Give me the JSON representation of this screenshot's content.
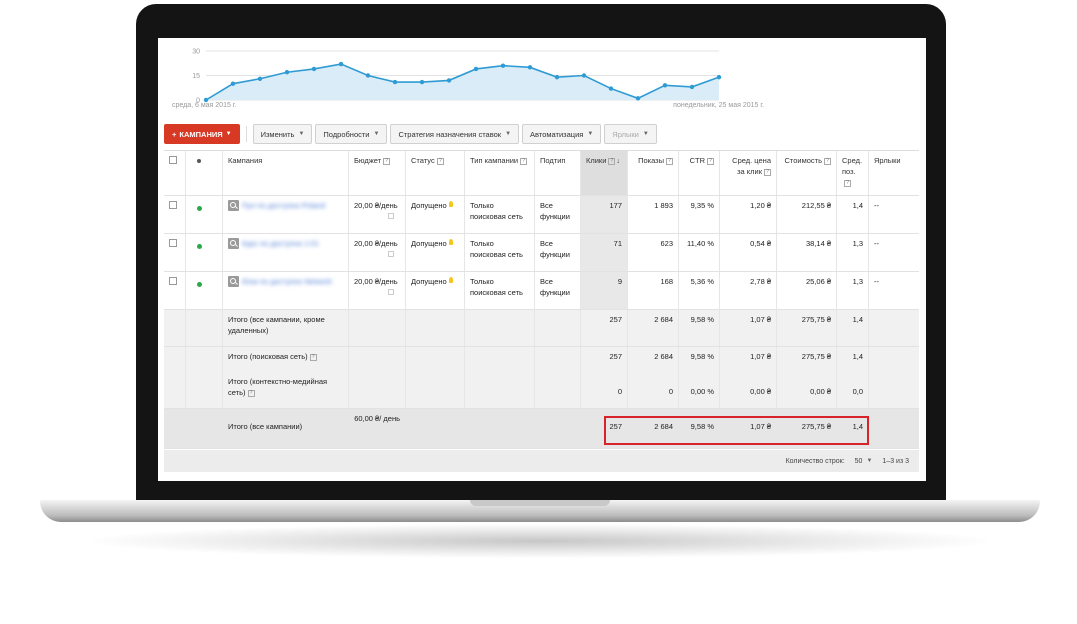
{
  "chart_data": {
    "type": "area",
    "title": "",
    "x_start_label": "среда, 6 мая 2015 г.",
    "x_end_label": "понедельник, 25 мая 2015 г.",
    "ylim": [
      0,
      30
    ],
    "y_ticks": [
      0,
      15,
      30
    ],
    "series": [
      {
        "values": [
          0,
          10,
          13,
          17,
          19,
          22,
          15,
          11,
          11,
          12,
          19,
          21,
          20,
          14,
          15,
          7,
          1,
          9,
          8,
          14
        ]
      }
    ],
    "colors": {
      "line": "#2f9bd4",
      "fill": "#d9ecf7"
    }
  },
  "toolbar": {
    "campaign_btn": "КАМПАНИЯ",
    "plus_icon": "plus-icon",
    "buttons": [
      "Изменить",
      "Подробности",
      "Стратегия назначения ставок",
      "Автоматизация",
      "Ярлыки"
    ]
  },
  "headers": {
    "campaign": "Кампания",
    "budget": "Бюджет",
    "status": "Статус",
    "campaign_type": "Тип кампании",
    "subtype": "Подтип",
    "clicks": "Клики",
    "impressions": "Показы",
    "ctr": "CTR",
    "avg_cpc": "Сред. цена за клик",
    "cost": "Стоимость",
    "avg_pos": "Сред. поз.",
    "labels": "Ярлыки"
  },
  "rows": [
    {
      "name": "Пул по доступно Poland",
      "budget": "20,00 ₴/день",
      "status": "Допущено",
      "type": "Только поисковая сеть",
      "subtype": "Все функции",
      "clicks": "177",
      "impressions": "1 893",
      "ctr": "9,35 %",
      "cpc": "1,20 ₴",
      "cost": "212,55 ₴",
      "pos": "1,4",
      "labels": "--"
    },
    {
      "name": "Курс по доступно 1:01",
      "budget": "20,00 ₴/день",
      "status": "Допущено",
      "type": "Только поисковая сеть",
      "subtype": "Все функции",
      "clicks": "71",
      "impressions": "623",
      "ctr": "11,40 %",
      "cpc": "0,54 ₴",
      "cost": "38,14 ₴",
      "pos": "1,3",
      "labels": "--"
    },
    {
      "name": "Юни по доступно Network",
      "budget": "20,00 ₴/день",
      "status": "Допущено",
      "type": "Только поисковая сеть",
      "subtype": "Все функции",
      "clicks": "9",
      "impressions": "168",
      "ctr": "5,36 %",
      "cpc": "2,78 ₴",
      "cost": "25,06 ₴",
      "pos": "1,3",
      "labels": "--"
    }
  ],
  "totals": [
    {
      "label": "Итого (все кампании, кроме удаленных)",
      "clicks": "257",
      "impressions": "2 684",
      "ctr": "9,58 %",
      "cpc": "1,07 ₴",
      "cost": "275,75 ₴",
      "pos": "1,4"
    },
    {
      "label": "Итого (поисковая сеть)",
      "clicks": "257",
      "impressions": "2 684",
      "ctr": "9,58 %",
      "cpc": "1,07 ₴",
      "cost": "275,75 ₴",
      "pos": "1,4"
    },
    {
      "label": "Итого (контекстно-медийная сеть)",
      "clicks": "0",
      "impressions": "0",
      "ctr": "0,00 %",
      "cpc": "0,00 ₴",
      "cost": "0,00 ₴",
      "pos": "0,0"
    }
  ],
  "grand_total": {
    "label": "Итого (все кампании)",
    "budget": "60,00 ₴/ день",
    "clicks": "257",
    "impressions": "2 684",
    "ctr": "9,58 %",
    "cpc": "1,07 ₴",
    "cost": "275,75 ₴",
    "pos": "1,4"
  },
  "footer": {
    "rows_label": "Количество строк:",
    "rows_value": "50",
    "range": "1–3 из 3"
  }
}
